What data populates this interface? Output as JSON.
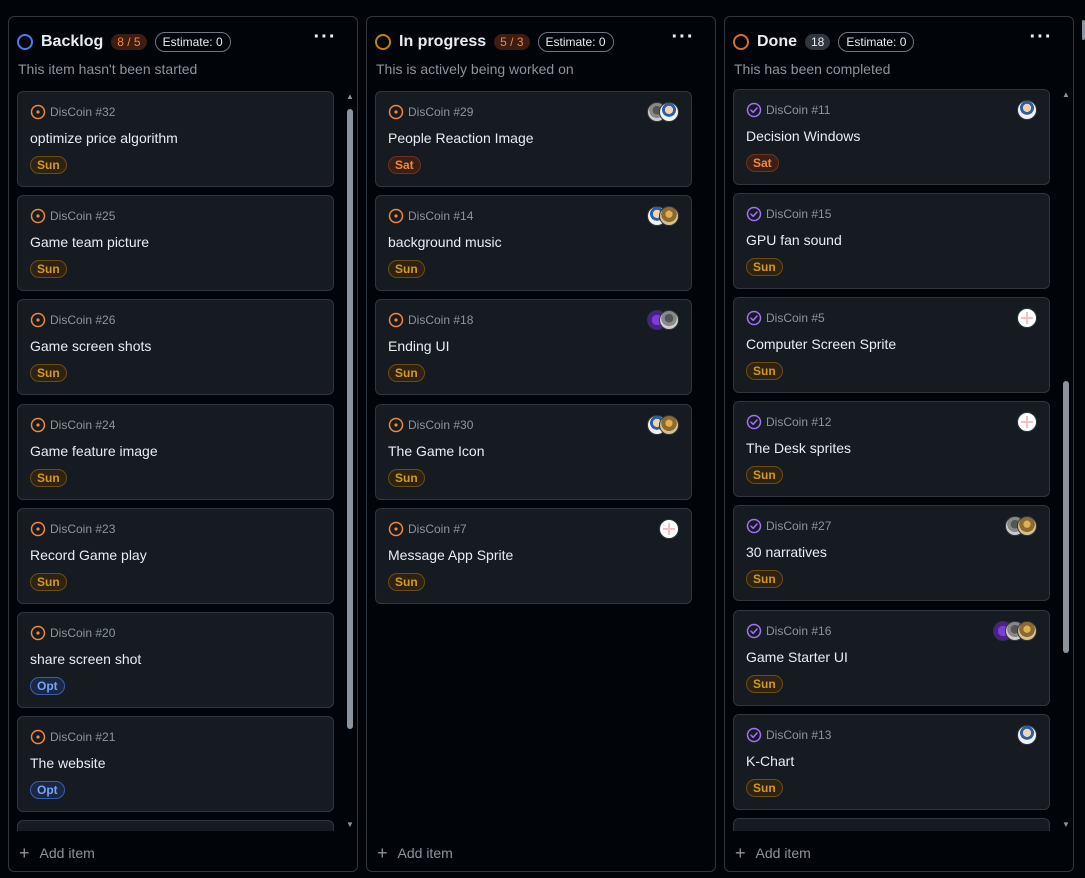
{
  "colors": {
    "todo": "#f0883e",
    "done": "#a371f7"
  },
  "columns": [
    {
      "title": "Backlog",
      "count": "8 / 5",
      "estimate": "Estimate: 0",
      "description": "This item hasn't been started",
      "add_label": "Add item",
      "cards": [
        {
          "ref": "DisCoin #32",
          "title": "optimize price algorithm",
          "label": "Sun"
        },
        {
          "ref": "DisCoin #25",
          "title": "Game team picture",
          "label": "Sun"
        },
        {
          "ref": "DisCoin #26",
          "title": "Game screen shots",
          "label": "Sun"
        },
        {
          "ref": "DisCoin #24",
          "title": "Game feature image",
          "label": "Sun"
        },
        {
          "ref": "DisCoin #23",
          "title": "Record Game play",
          "label": "Sun"
        },
        {
          "ref": "DisCoin #20",
          "title": "share screen shot",
          "label": "Opt"
        },
        {
          "ref": "DisCoin #21",
          "title": "The website",
          "label": "Opt"
        }
      ]
    },
    {
      "title": "In progress",
      "count": "5 / 3",
      "estimate": "Estimate: 0",
      "description": "This is actively being worked on",
      "add_label": "Add item",
      "cards": [
        {
          "ref": "DisCoin #29",
          "title": "People Reaction Image",
          "label": "Sat"
        },
        {
          "ref": "DisCoin #14",
          "title": "background music",
          "label": "Sun"
        },
        {
          "ref": "DisCoin #18",
          "title": "Ending UI",
          "label": "Sun"
        },
        {
          "ref": "DisCoin #30",
          "title": "The Game Icon",
          "label": "Sun"
        },
        {
          "ref": "DisCoin #7",
          "title": "Message App Sprite",
          "label": "Sun"
        }
      ]
    },
    {
      "title": "Done",
      "count": "18",
      "estimate": "Estimate: 0",
      "description": "This has been completed",
      "add_label": "Add item",
      "cards": [
        {
          "ref": "DisCoin #11",
          "title": "Decision Windows",
          "label": "Sat"
        },
        {
          "ref": "DisCoin #15",
          "title": "GPU fan sound",
          "label": "Sun"
        },
        {
          "ref": "DisCoin #5",
          "title": "Computer Screen Sprite",
          "label": "Sun"
        },
        {
          "ref": "DisCoin #12",
          "title": "The Desk sprites",
          "label": "Sun"
        },
        {
          "ref": "DisCoin #27",
          "title": "30 narratives",
          "label": "Sun"
        },
        {
          "ref": "DisCoin #16",
          "title": "Game Starter UI",
          "label": "Sun"
        },
        {
          "ref": "DisCoin #13",
          "title": "K-Chart",
          "label": "Sun"
        }
      ]
    }
  ]
}
